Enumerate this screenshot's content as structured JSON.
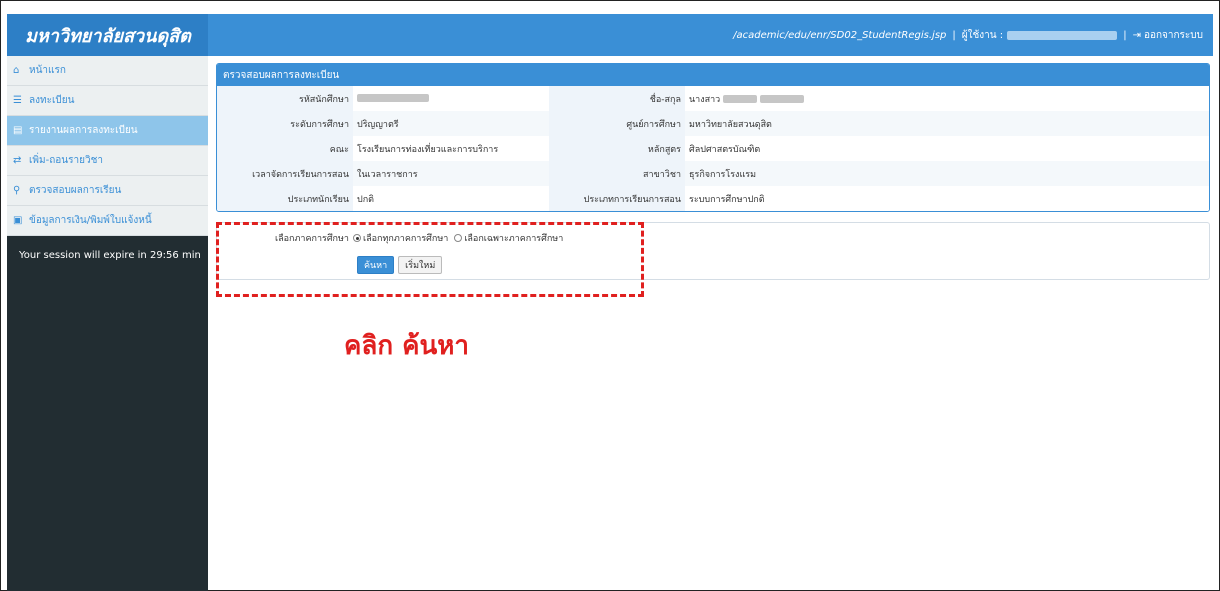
{
  "header": {
    "brand": "มหาวิทยาลัยสวนดุสิต",
    "path": "/academic/edu/enr/SD02_StudentRegis.jsp",
    "sep1": "|",
    "user_label": "ผู้ใช้งาน :",
    "sep2": "|",
    "logout_label": "ออกจากระบบ"
  },
  "sidebar": {
    "items": [
      {
        "icon": "home-icon",
        "glyph": "⌂",
        "label": "หน้าแรก"
      },
      {
        "icon": "list-icon",
        "glyph": "☰",
        "label": "ลงทะเบียน"
      },
      {
        "icon": "document-icon",
        "glyph": "▤",
        "label": "รายงานผลการลงทะเบียน"
      },
      {
        "icon": "exchange-icon",
        "glyph": "⇄",
        "label": "เพิ่ม-ถอนรายวิชา"
      },
      {
        "icon": "search-icon",
        "glyph": "⚲",
        "label": "ตรวจสอบผลการเรียน"
      },
      {
        "icon": "money-icon",
        "glyph": "▣",
        "label": "ข้อมูลการเงิน/พิมพ์ใบแจ้งหนี้"
      }
    ],
    "active_index": 2,
    "session_text": "Your session will expire in 29:56 min"
  },
  "panel": {
    "title": "ตรวจสอบผลการลงทะเบียน",
    "rows": [
      {
        "l1": "รหัสนักศึกษา",
        "v1": "",
        "l2": "ชื่อ-สกุล",
        "v2": "นางสาว"
      },
      {
        "l1": "ระดับการศึกษา",
        "v1": "ปริญญาตรี",
        "l2": "ศูนย์การศึกษา",
        "v2": "มหาวิทยาลัยสวนดุสิต"
      },
      {
        "l1": "คณะ",
        "v1": "โรงเรียนการท่องเที่ยวและการบริการ",
        "l2": "หลักสูตร",
        "v2": "ศิลปศาสตรบัณฑิต"
      },
      {
        "l1": "เวลาจัดการเรียนการสอน",
        "v1": "ในเวลาราชการ",
        "l2": "สาขาวิชา",
        "v2": "ธุรกิจการโรงแรม"
      },
      {
        "l1": "ประเภทนักเรียน",
        "v1": "ปกติ",
        "l2": "ประเภทการเรียนการสอน",
        "v2": "ระบบการศึกษาปกติ"
      }
    ]
  },
  "term": {
    "label": "เลือกภาคการศึกษา",
    "option_all": "เลือกทุกภาคการศึกษา",
    "option_one": "เลือกเฉพาะภาคการศึกษา",
    "selected": "all",
    "search_btn": "ค้นหา",
    "reset_btn": "เริ่มใหม่"
  },
  "annotation": {
    "callout": "คลิก ค้นหา",
    "color": "#e0201f"
  },
  "colors": {
    "accent": "#3a8fd6",
    "sidebar_bg": "#222d32"
  }
}
